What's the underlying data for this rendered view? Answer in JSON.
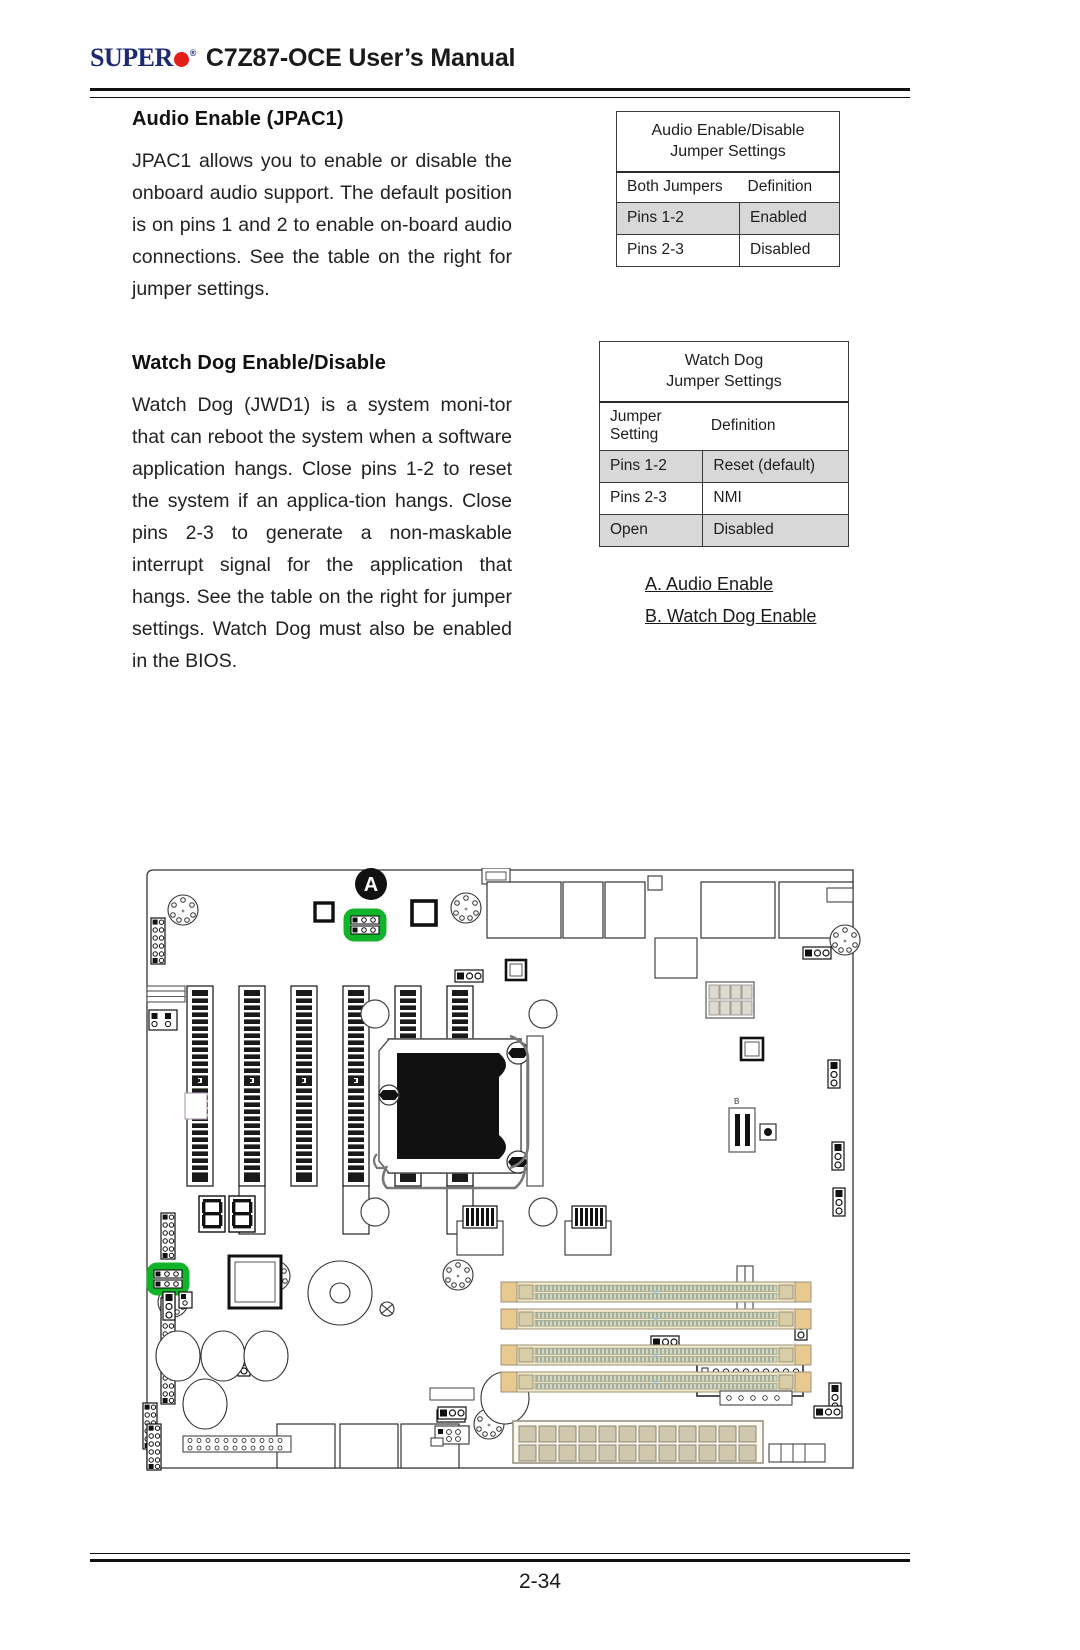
{
  "header": {
    "logo_word": "SUPER",
    "logo_dot": "red-dot",
    "logo_registered": "®",
    "title": "C7Z87-OCE User’s Manual"
  },
  "sections": [
    {
      "heading": "Audio Enable (JPAC1)",
      "body": "JPAC1 allows you to enable or disable the onboard audio support. The default position is on pins 1 and 2 to enable on-board audio connections. See the table on the right for jumper settings."
    },
    {
      "heading": "Watch Dog Enable/Disable",
      "body": "Watch Dog (JWD1) is a system moni-tor that can reboot the system when a software application hangs. Close pins 1-2 to reset the system if an applica-tion hangs. Close pins 2-3 to generate a non-maskable interrupt signal for the application that hangs. See the table on the right for jumper settings. Watch Dog must also be enabled in the BIOS."
    }
  ],
  "tables": {
    "audio": {
      "title_line1": "Audio Enable/Disable",
      "title_line2": "Jumper Settings",
      "columns": [
        "Both Jumpers",
        "Definition"
      ],
      "rows": [
        {
          "setting": "Pins 1-2",
          "definition": "Enabled",
          "shaded": true
        },
        {
          "setting": "Pins 2-3",
          "definition": "Disabled",
          "shaded": false
        }
      ]
    },
    "watchdog": {
      "title_line1": "Watch Dog",
      "title_line2": "Jumper Settings",
      "columns": [
        "Jumper Setting",
        "Definition"
      ],
      "rows": [
        {
          "setting": "Pins 1-2",
          "definition": "Reset (default)",
          "shaded": true
        },
        {
          "setting": "Pins 2-3",
          "definition": "NMI",
          "shaded": false
        },
        {
          "setting": "Open",
          "definition": "Disabled",
          "shaded": true
        }
      ]
    }
  },
  "legend": [
    "A. Audio Enable",
    "B. Watch Dog Enable"
  ],
  "figure": {
    "callouts": [
      {
        "label": "A",
        "target": "jpac1-jumper"
      },
      {
        "label": "B",
        "target": "jwd1-jumper"
      }
    ],
    "highlight_color": "#11b428"
  },
  "footer": {
    "page_number": "2-34"
  }
}
